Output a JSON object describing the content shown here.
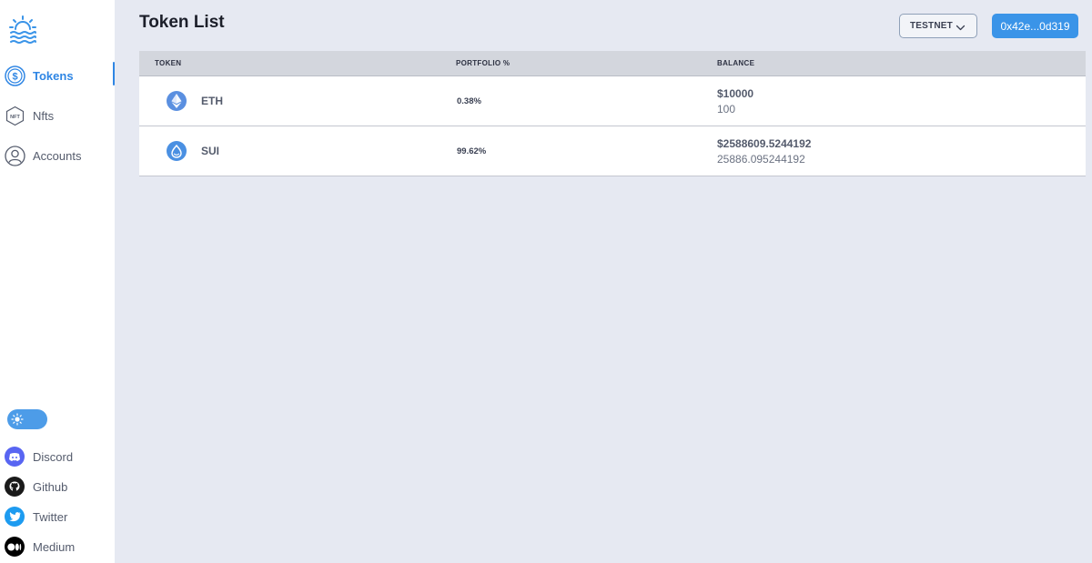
{
  "sidebar": {
    "nav": [
      {
        "label": "Tokens",
        "icon": "dollar-coin-icon",
        "active": true
      },
      {
        "label": "Nfts",
        "icon": "nft-icon",
        "active": false
      },
      {
        "label": "Accounts",
        "icon": "user-icon",
        "active": false
      }
    ],
    "theme_toggle": {
      "icon": "sun-icon",
      "state": "light"
    },
    "social": [
      {
        "label": "Discord",
        "icon": "discord-icon"
      },
      {
        "label": "Github",
        "icon": "github-icon"
      },
      {
        "label": "Twitter",
        "icon": "twitter-icon"
      },
      {
        "label": "Medium",
        "icon": "medium-icon"
      }
    ]
  },
  "header": {
    "title": "Token List",
    "network": "TESTNET",
    "wallet_address": "0x42e...0d319"
  },
  "table": {
    "columns": [
      "TOKEN",
      "PORTFOLIO %",
      "BALANCE"
    ],
    "rows": [
      {
        "symbol": "ETH",
        "icon": "ethereum-icon",
        "portfolio": "0.38%",
        "usd": "$10000",
        "amount": "100"
      },
      {
        "symbol": "SUI",
        "icon": "sui-icon",
        "portfolio": "99.62%",
        "usd": "$2588609.5244192",
        "amount": "25886.095244192"
      }
    ]
  },
  "colors": {
    "accent": "#2f86e4",
    "button": "#3a94e8",
    "background": "#e6e9f2",
    "sidebar": "#ffffff"
  }
}
